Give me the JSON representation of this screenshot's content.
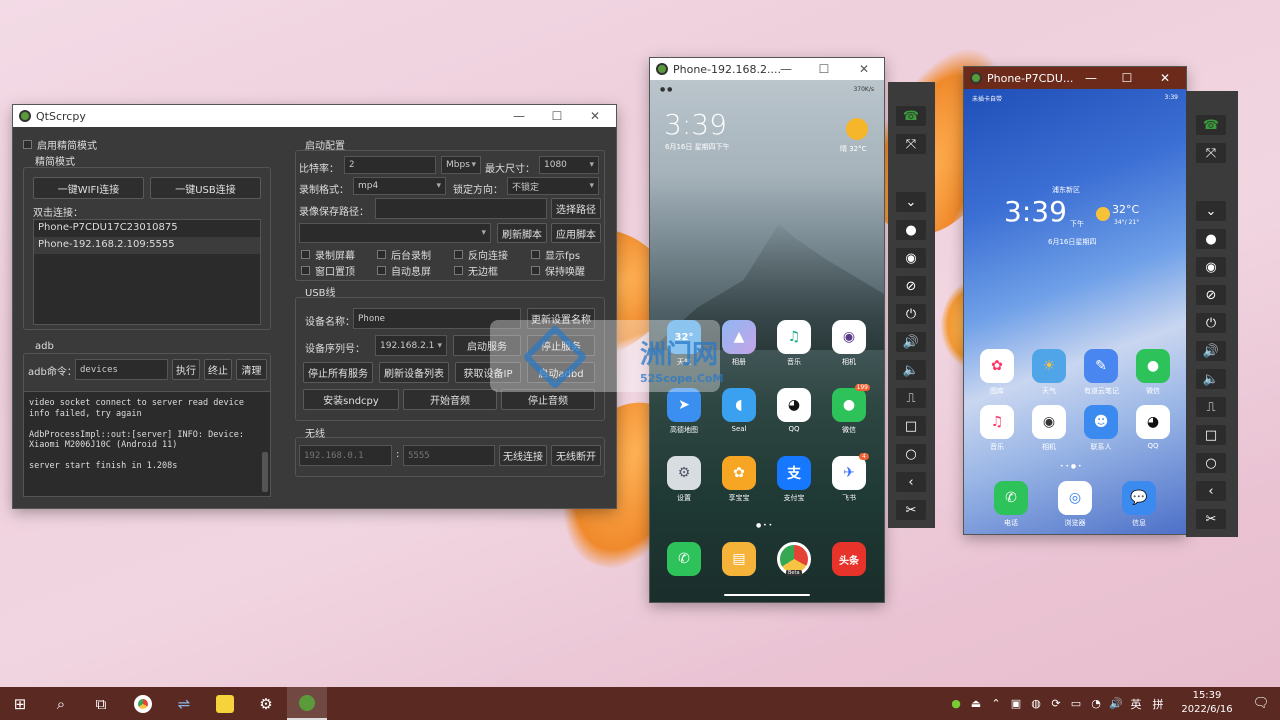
{
  "main_window": {
    "title": "QtScrcpy",
    "simple_mode_checkbox": "启用精简模式",
    "simple_mode_group": "精简模式",
    "btn_wifi_connect": "一键WIFI连接",
    "btn_usb_connect": "一键USB连接",
    "double_click_label": "双击连接：",
    "devices": [
      "Phone-P7CDU17C23010875",
      "Phone-192.168.2.109:5555"
    ],
    "adb_group": "adb",
    "adb_cmd_label": "adb命令：",
    "adb_cmd_value": "devices",
    "btn_execute": "执行",
    "btn_terminate": "终止",
    "btn_clear": "清理",
    "log_lines": [
      "video socket connect to server read device",
      "info failed, try again",
      "",
      "AdbProcessImpl::out:[server] INFO: Device:",
      "Xiaomi M2006J10C (Android 11)",
      "",
      "server start finish in 1.208s"
    ],
    "start_config_group": "启动配置",
    "bitrate_label": "比特率：",
    "bitrate_value": "2",
    "bitrate_unit": "Mbps",
    "max_size_label": "最大尺寸：",
    "max_size_value": "1080",
    "record_format_label": "录制格式：",
    "record_format_value": "mp4",
    "lock_orientation_label": "锁定方向：",
    "lock_orientation_value": "不锁定",
    "record_path_label": "录像保存路径：",
    "record_path_value": "",
    "btn_select_path": "选择路径",
    "btn_refresh_script": "刷新脚本",
    "btn_apply_script": "应用脚本",
    "checkboxes_row1": [
      "录制屏幕",
      "后台录制",
      "反向连接",
      "显示fps"
    ],
    "checkboxes_row2": [
      "窗口置顶",
      "自动息屏",
      "无边框",
      "保持唤醒"
    ],
    "usb_group": "USB线",
    "device_name_label": "设备名称：",
    "device_name_value": "Phone",
    "btn_update_name": "更新设置名称",
    "device_serial_label": "设备序列号：",
    "device_serial_value": "192.168.2.1",
    "btn_start_service": "启动服务",
    "btn_stop_service": "停止服务",
    "btn_stop_all": "停止所有服务",
    "btn_refresh_devices": "刷新设备列表",
    "btn_get_ip": "获取设备IP",
    "btn_start_adbd": "启动adbd",
    "btn_install_sndcpy": "安装sndcpy",
    "btn_start_audio": "开始音频",
    "btn_stop_audio": "停止音频",
    "wireless_group": "无线",
    "ip_placeholder": "192.168.0.1",
    "port_placeholder": "5555",
    "btn_wireless_connect": "无线连接",
    "btn_wireless_disconnect": "无线断开"
  },
  "phone1": {
    "title": "Phone-192.168.2....",
    "status_speed": "370K/s",
    "time": "3:39",
    "date": "6月16日 星期四下午",
    "weather": "晴 32°C",
    "apps_row1": [
      "天气",
      "相册",
      "音乐",
      "相机"
    ],
    "apps_row2": [
      "高德地图",
      "Seal",
      "QQ",
      "微信"
    ],
    "apps_row3": [
      "设置",
      "享宝宝",
      "支付宝",
      "飞书"
    ],
    "weather_icon_text": "32°",
    "alipay_glyph": "支",
    "headline_glyph": "头条",
    "wechat_badge": "199",
    "feishu_badge": "4",
    "chrome_badge": "Beta"
  },
  "phone2": {
    "title": "Phone-P7CDU...",
    "carrier": "未插卡自带",
    "status_time": "3:39",
    "location": "浦东新区",
    "time": "3:39",
    "time_suffix": "下午",
    "temp": "32°C",
    "temp_range": "34°/ 21°",
    "date": "6月16日星期四",
    "apps_row1": [
      "图库",
      "天气",
      "有道云笔记",
      "微信"
    ],
    "apps_row2": [
      "音乐",
      "相机",
      "联系人",
      "QQ"
    ],
    "dock": [
      "电话",
      "浏览器",
      "信息"
    ]
  },
  "watermark": {
    "name": "洲门网",
    "url": "52Scope.CoM"
  },
  "taskbar": {
    "time": "15:39",
    "date": "2022/6/16",
    "ime": "英",
    "ime2": "拼"
  }
}
